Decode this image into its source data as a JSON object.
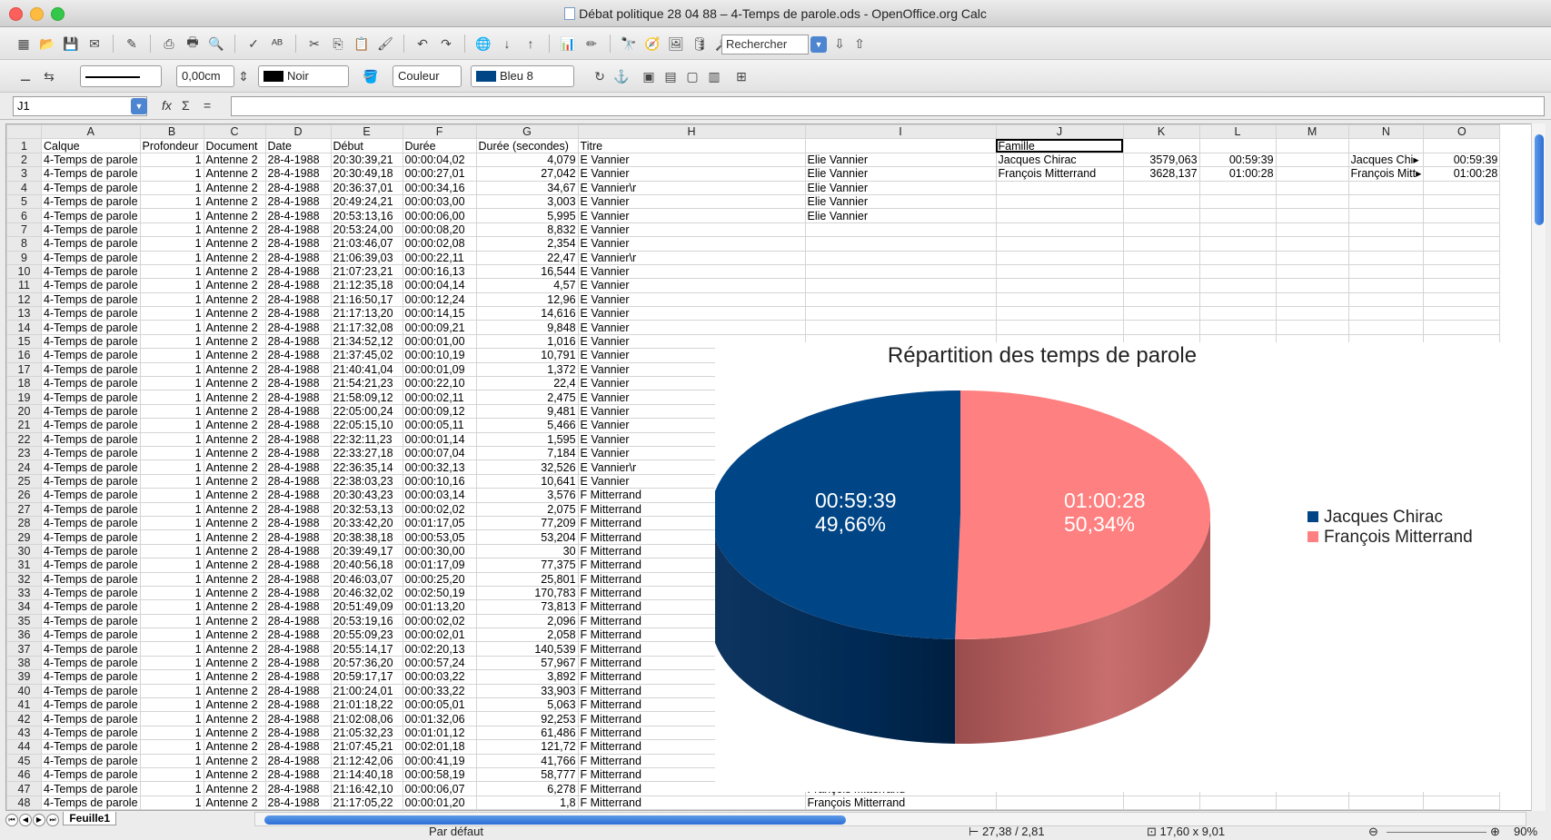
{
  "window": {
    "title": "Débat politique 28 04 88 – 4-Temps de parole.ods - OpenOffice.org Calc"
  },
  "toolbar": {
    "search_placeholder": "Rechercher",
    "line_width": "0,00cm",
    "line_color": "Noir",
    "area_style": "Couleur",
    "area_color": "Bleu 8"
  },
  "formula": {
    "cell_ref": "J1",
    "content": ""
  },
  "columns": [
    "A",
    "B",
    "C",
    "D",
    "E",
    "F",
    "G",
    "H",
    "I",
    "J",
    "K",
    "L",
    "M",
    "N",
    "O"
  ],
  "header_row": [
    "Calque",
    "Profondeur",
    "Document",
    "Date",
    "Début",
    "Durée",
    "Durée (secondes)",
    "Titre",
    "",
    "Famille",
    "",
    "",
    "",
    "",
    ""
  ],
  "rows": [
    [
      "4-Temps de parole",
      "1",
      "Antenne 2",
      "28-4-1988",
      "20:30:39,21",
      "00:00:04,02",
      "4,079",
      "E Vannier",
      "Elie Vannier",
      "Jacques Chirac",
      "3579,063",
      "00:59:39",
      "",
      "Jacques Chi▸",
      "00:59:39"
    ],
    [
      "4-Temps de parole",
      "1",
      "Antenne 2",
      "28-4-1988",
      "20:30:49,18",
      "00:00:27,01",
      "27,042",
      "E Vannier",
      "Elie Vannier",
      "François Mitterrand",
      "3628,137",
      "01:00:28",
      "",
      "François Mitt▸",
      "01:00:28"
    ],
    [
      "4-Temps de parole",
      "1",
      "Antenne 2",
      "28-4-1988",
      "20:36:37,01",
      "00:00:34,16",
      "34,67",
      "E Vannier\\r",
      "Elie Vannier",
      "",
      "",
      "",
      "",
      "",
      ""
    ],
    [
      "4-Temps de parole",
      "1",
      "Antenne 2",
      "28-4-1988",
      "20:49:24,21",
      "00:00:03,00",
      "3,003",
      "E Vannier",
      "Elie Vannier",
      "",
      "",
      "",
      "",
      "",
      ""
    ],
    [
      "4-Temps de parole",
      "1",
      "Antenne 2",
      "28-4-1988",
      "20:53:13,16",
      "00:00:06,00",
      "5,995",
      "E Vannier",
      "Elie Vannier",
      "",
      "",
      "",
      "",
      "",
      ""
    ],
    [
      "4-Temps de parole",
      "1",
      "Antenne 2",
      "28-4-1988",
      "20:53:24,00",
      "00:00:08,20",
      "8,832",
      "E Vannier",
      "",
      "",
      "",
      "",
      "",
      "",
      ""
    ],
    [
      "4-Temps de parole",
      "1",
      "Antenne 2",
      "28-4-1988",
      "21:03:46,07",
      "00:00:02,08",
      "2,354",
      "E Vannier",
      "",
      "",
      "",
      "",
      "",
      "",
      ""
    ],
    [
      "4-Temps de parole",
      "1",
      "Antenne 2",
      "28-4-1988",
      "21:06:39,03",
      "00:00:22,11",
      "22,47",
      "E Vannier\\r",
      "",
      "",
      "",
      "",
      "",
      "",
      ""
    ],
    [
      "4-Temps de parole",
      "1",
      "Antenne 2",
      "28-4-1988",
      "21:07:23,21",
      "00:00:16,13",
      "16,544",
      "E Vannier",
      "",
      "",
      "",
      "",
      "",
      "",
      ""
    ],
    [
      "4-Temps de parole",
      "1",
      "Antenne 2",
      "28-4-1988",
      "21:12:35,18",
      "00:00:04,14",
      "4,57",
      "E Vannier",
      "",
      "",
      "",
      "",
      "",
      "",
      ""
    ],
    [
      "4-Temps de parole",
      "1",
      "Antenne 2",
      "28-4-1988",
      "21:16:50,17",
      "00:00:12,24",
      "12,96",
      "E Vannier",
      "",
      "",
      "",
      "",
      "",
      "",
      ""
    ],
    [
      "4-Temps de parole",
      "1",
      "Antenne 2",
      "28-4-1988",
      "21:17:13,20",
      "00:00:14,15",
      "14,616",
      "E Vannier",
      "",
      "",
      "",
      "",
      "",
      "",
      ""
    ],
    [
      "4-Temps de parole",
      "1",
      "Antenne 2",
      "28-4-1988",
      "21:17:32,08",
      "00:00:09,21",
      "9,848",
      "E Vannier",
      "",
      "",
      "",
      "",
      "",
      "",
      ""
    ],
    [
      "4-Temps de parole",
      "1",
      "Antenne 2",
      "28-4-1988",
      "21:34:52,12",
      "00:00:01,00",
      "1,016",
      "E Vannier",
      "",
      "",
      "",
      "",
      "",
      "",
      ""
    ],
    [
      "4-Temps de parole",
      "1",
      "Antenne 2",
      "28-4-1988",
      "21:37:45,02",
      "00:00:10,19",
      "10,791",
      "E Vannier",
      "",
      "",
      "",
      "",
      "",
      "",
      ""
    ],
    [
      "4-Temps de parole",
      "1",
      "Antenne 2",
      "28-4-1988",
      "21:40:41,04",
      "00:00:01,09",
      "1,372",
      "E Vannier",
      "",
      "",
      "",
      "",
      "",
      "",
      ""
    ],
    [
      "4-Temps de parole",
      "1",
      "Antenne 2",
      "28-4-1988",
      "21:54:21,23",
      "00:00:22,10",
      "22,4",
      "E Vannier",
      "",
      "",
      "",
      "",
      "",
      "",
      ""
    ],
    [
      "4-Temps de parole",
      "1",
      "Antenne 2",
      "28-4-1988",
      "21:58:09,12",
      "00:00:02,11",
      "2,475",
      "E Vannier",
      "",
      "",
      "",
      "",
      "",
      "",
      ""
    ],
    [
      "4-Temps de parole",
      "1",
      "Antenne 2",
      "28-4-1988",
      "22:05:00,24",
      "00:00:09,12",
      "9,481",
      "E Vannier",
      "",
      "",
      "",
      "",
      "",
      "",
      ""
    ],
    [
      "4-Temps de parole",
      "1",
      "Antenne 2",
      "28-4-1988",
      "22:05:15,10",
      "00:00:05,11",
      "5,466",
      "E Vannier",
      "",
      "",
      "",
      "",
      "",
      "",
      ""
    ],
    [
      "4-Temps de parole",
      "1",
      "Antenne 2",
      "28-4-1988",
      "22:32:11,23",
      "00:00:01,14",
      "1,595",
      "E Vannier",
      "",
      "",
      "",
      "",
      "",
      "",
      ""
    ],
    [
      "4-Temps de parole",
      "1",
      "Antenne 2",
      "28-4-1988",
      "22:33:27,18",
      "00:00:07,04",
      "7,184",
      "E Vannier",
      "",
      "",
      "",
      "",
      "",
      "",
      ""
    ],
    [
      "4-Temps de parole",
      "1",
      "Antenne 2",
      "28-4-1988",
      "22:36:35,14",
      "00:00:32,13",
      "32,526",
      "E Vannier\\r",
      "",
      "",
      "",
      "",
      "",
      "",
      ""
    ],
    [
      "4-Temps de parole",
      "1",
      "Antenne 2",
      "28-4-1988",
      "22:38:03,23",
      "00:00:10,16",
      "10,641",
      "E Vannier",
      "",
      "",
      "",
      "",
      "",
      "",
      ""
    ],
    [
      "4-Temps de parole",
      "1",
      "Antenne 2",
      "28-4-1988",
      "20:30:43,23",
      "00:00:03,14",
      "3,576",
      "F Mitterrand",
      "",
      "",
      "",
      "",
      "",
      "",
      ""
    ],
    [
      "4-Temps de parole",
      "1",
      "Antenne 2",
      "28-4-1988",
      "20:32:53,13",
      "00:00:02,02",
      "2,075",
      "F Mitterrand",
      "",
      "",
      "",
      "",
      "",
      "",
      ""
    ],
    [
      "4-Temps de parole",
      "1",
      "Antenne 2",
      "28-4-1988",
      "20:33:42,20",
      "00:01:17,05",
      "77,209",
      "F Mitterrand",
      "",
      "",
      "",
      "",
      "",
      "",
      ""
    ],
    [
      "4-Temps de parole",
      "1",
      "Antenne 2",
      "28-4-1988",
      "20:38:38,18",
      "00:00:53,05",
      "53,204",
      "F Mitterrand",
      "",
      "",
      "",
      "",
      "",
      "",
      ""
    ],
    [
      "4-Temps de parole",
      "1",
      "Antenne 2",
      "28-4-1988",
      "20:39:49,17",
      "00:00:30,00",
      "30",
      "F Mitterrand",
      "",
      "",
      "",
      "",
      "",
      "",
      ""
    ],
    [
      "4-Temps de parole",
      "1",
      "Antenne 2",
      "28-4-1988",
      "20:40:56,18",
      "00:01:17,09",
      "77,375",
      "F Mitterrand",
      "",
      "",
      "",
      "",
      "",
      "",
      ""
    ],
    [
      "4-Temps de parole",
      "1",
      "Antenne 2",
      "28-4-1988",
      "20:46:03,07",
      "00:00:25,20",
      "25,801",
      "F Mitterrand",
      "",
      "",
      "",
      "",
      "",
      "",
      ""
    ],
    [
      "4-Temps de parole",
      "1",
      "Antenne 2",
      "28-4-1988",
      "20:46:32,02",
      "00:02:50,19",
      "170,783",
      "F Mitterrand",
      "",
      "",
      "",
      "",
      "",
      "",
      ""
    ],
    [
      "4-Temps de parole",
      "1",
      "Antenne 2",
      "28-4-1988",
      "20:51:49,09",
      "00:01:13,20",
      "73,813",
      "F Mitterrand",
      "",
      "",
      "",
      "",
      "",
      "",
      ""
    ],
    [
      "4-Temps de parole",
      "1",
      "Antenne 2",
      "28-4-1988",
      "20:53:19,16",
      "00:00:02,02",
      "2,096",
      "F Mitterrand",
      "",
      "",
      "",
      "",
      "",
      "",
      ""
    ],
    [
      "4-Temps de parole",
      "1",
      "Antenne 2",
      "28-4-1988",
      "20:55:09,23",
      "00:00:02,01",
      "2,058",
      "F Mitterrand",
      "",
      "",
      "",
      "",
      "",
      "",
      ""
    ],
    [
      "4-Temps de parole",
      "1",
      "Antenne 2",
      "28-4-1988",
      "20:55:14,17",
      "00:02:20,13",
      "140,539",
      "F Mitterrand",
      "",
      "",
      "",
      "",
      "",
      "",
      ""
    ],
    [
      "4-Temps de parole",
      "1",
      "Antenne 2",
      "28-4-1988",
      "20:57:36,20",
      "00:00:57,24",
      "57,967",
      "F Mitterrand",
      "",
      "",
      "",
      "",
      "",
      "",
      ""
    ],
    [
      "4-Temps de parole",
      "1",
      "Antenne 2",
      "28-4-1988",
      "20:59:17,17",
      "00:00:03,22",
      "3,892",
      "F Mitterrand",
      "François Mitterrand",
      "",
      "",
      "",
      "",
      "",
      ""
    ],
    [
      "4-Temps de parole",
      "1",
      "Antenne 2",
      "28-4-1988",
      "21:00:24,01",
      "00:00:33,22",
      "33,903",
      "F Mitterrand",
      "François Mitterrand",
      "",
      "",
      "",
      "",
      "",
      ""
    ],
    [
      "4-Temps de parole",
      "1",
      "Antenne 2",
      "28-4-1988",
      "21:01:18,22",
      "00:00:05,01",
      "5,063",
      "F Mitterrand",
      "François Mitterrand",
      "",
      "",
      "",
      "",
      "",
      ""
    ],
    [
      "4-Temps de parole",
      "1",
      "Antenne 2",
      "28-4-1988",
      "21:02:08,06",
      "00:01:32,06",
      "92,253",
      "F Mitterrand",
      "François Mitterrand",
      "",
      "",
      "",
      "",
      "",
      ""
    ],
    [
      "4-Temps de parole",
      "1",
      "Antenne 2",
      "28-4-1988",
      "21:05:32,23",
      "00:01:01,12",
      "61,486",
      "F Mitterrand",
      "François Mitterrand",
      "",
      "",
      "",
      "",
      "",
      ""
    ],
    [
      "4-Temps de parole",
      "1",
      "Antenne 2",
      "28-4-1988",
      "21:07:45,21",
      "00:02:01,18",
      "121,72",
      "F Mitterrand",
      "François Mitterrand",
      "",
      "",
      "",
      "",
      "",
      ""
    ],
    [
      "4-Temps de parole",
      "1",
      "Antenne 2",
      "28-4-1988",
      "21:12:42,06",
      "00:00:41,19",
      "41,766",
      "F Mitterrand",
      "François Mitterrand",
      "",
      "",
      "",
      "",
      "",
      ""
    ],
    [
      "4-Temps de parole",
      "1",
      "Antenne 2",
      "28-4-1988",
      "21:14:40,18",
      "00:00:58,19",
      "58,777",
      "F Mitterrand",
      "François Mitterrand",
      "",
      "",
      "",
      "",
      "",
      ""
    ],
    [
      "4-Temps de parole",
      "1",
      "Antenne 2",
      "28-4-1988",
      "21:16:42,10",
      "00:00:06,07",
      "6,278",
      "F Mitterrand",
      "François Mitterrand",
      "",
      "",
      "",
      "",
      "",
      ""
    ],
    [
      "4-Temps de parole",
      "1",
      "Antenne 2",
      "28-4-1988",
      "21:17:05,22",
      "00:00:01,20",
      "1,8",
      "F Mitterrand",
      "François Mitterrand",
      "",
      "",
      "",
      "",
      "",
      ""
    ]
  ],
  "chart_data": {
    "type": "pie",
    "title": "Répartition des temps de parole",
    "categories": [
      "Jacques Chirac",
      "François Mitterrand"
    ],
    "values": [
      49.66,
      50.34
    ],
    "data_labels": [
      [
        "00:59:39",
        "49,66%"
      ],
      [
        "01:00:28",
        "50,34%"
      ]
    ],
    "colors": [
      "#004586",
      "#ff8080"
    ],
    "legend": "right",
    "style": "3d"
  },
  "sheet": {
    "tab": "Feuille1"
  },
  "status": {
    "page_style": "Par défaut",
    "position": "27,38 / 2,81",
    "size": "17,60 x 9,01",
    "zoom": "90%"
  }
}
